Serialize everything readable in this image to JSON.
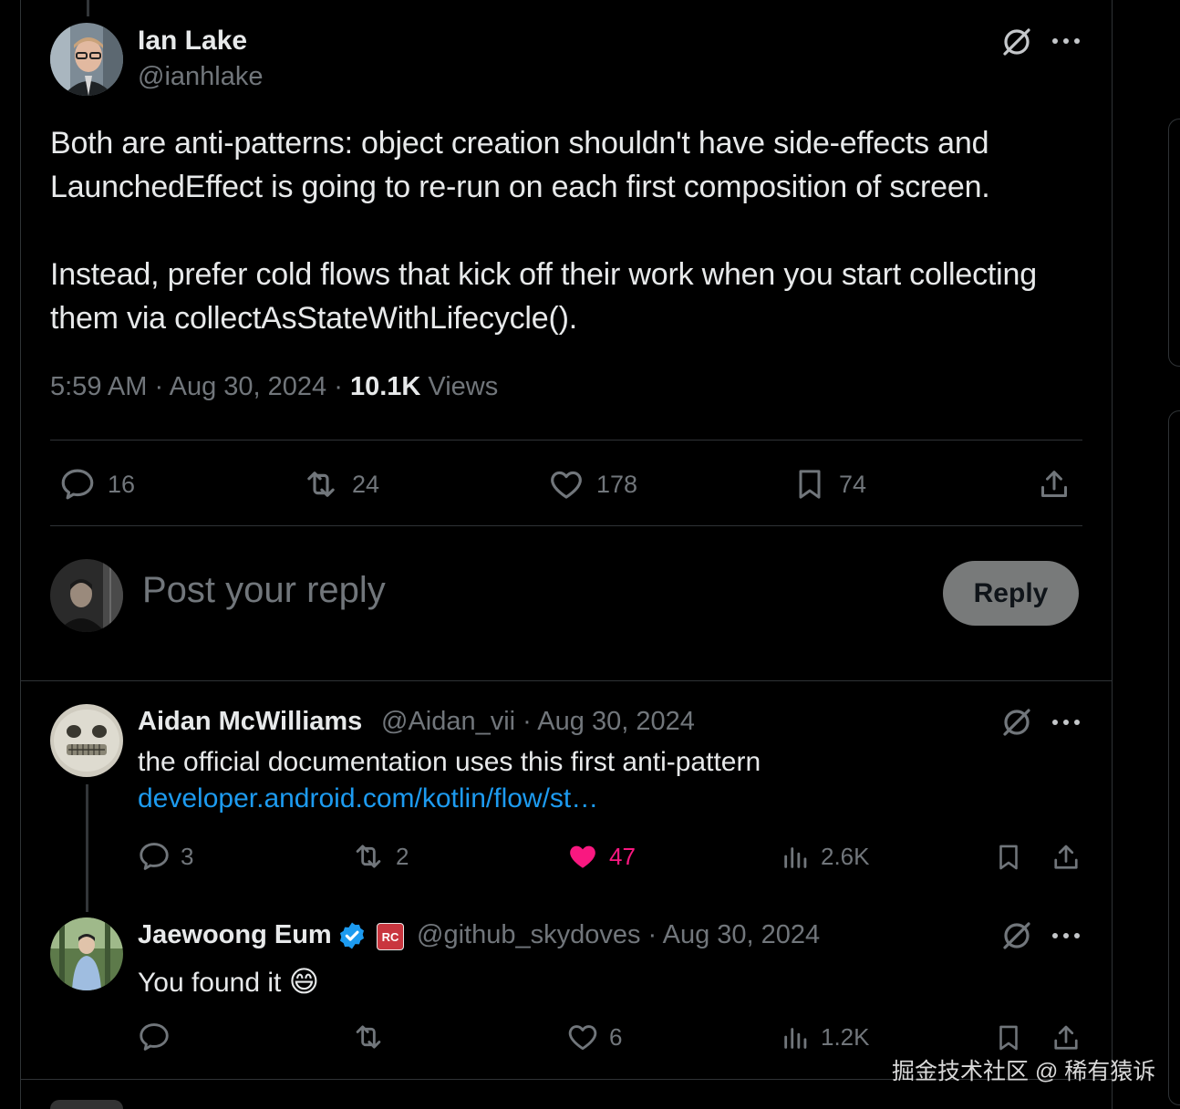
{
  "tweet": {
    "author_name": "Ian Lake",
    "author_handle": "@ianhlake",
    "paragraph_1": "Both are anti-patterns: object creation shouldn't have side-effects and LaunchedEffect is going to re-run on each first composition of screen.",
    "paragraph_2": "Instead, prefer cold flows that kick off their work when you start collecting them via collectAsStateWithLifecycle().",
    "time": "5:59 AM",
    "sep": "·",
    "date": "Aug 30, 2024",
    "views_count": "10.1K",
    "views_label": "Views",
    "stats": {
      "replies": "16",
      "reposts": "24",
      "likes": "178",
      "bookmarks": "74"
    }
  },
  "composer": {
    "placeholder": "Post your reply",
    "button_label": "Reply"
  },
  "replies": [
    {
      "author_name": "Aidan McWilliams",
      "handle_date": "@Aidan_vii · Aug 30, 2024",
      "text": "the official documentation uses this first anti-pattern",
      "link": "developer.android.com/kotlin/flow/st…",
      "stats": {
        "replies": "3",
        "reposts": "2",
        "likes": "47",
        "views": "2.6K"
      }
    },
    {
      "author_name": "Jaewoong Eum",
      "badge_label": "RC",
      "handle_date": "@github_skydoves · Aug 30, 2024",
      "text": "You found it",
      "emoji": "😄",
      "stats": {
        "replies": "",
        "reposts": "",
        "likes": "6",
        "views": "1.2K"
      }
    }
  ],
  "watermark": "掘金技术社区 @ 稀有猿诉",
  "colors": {
    "background": "#000000",
    "text": "#e7e9ea",
    "muted": "#71767b",
    "link": "#1d9bf0",
    "like": "#f91880",
    "verified": "#1d9bf0",
    "divider": "#2f3336"
  }
}
